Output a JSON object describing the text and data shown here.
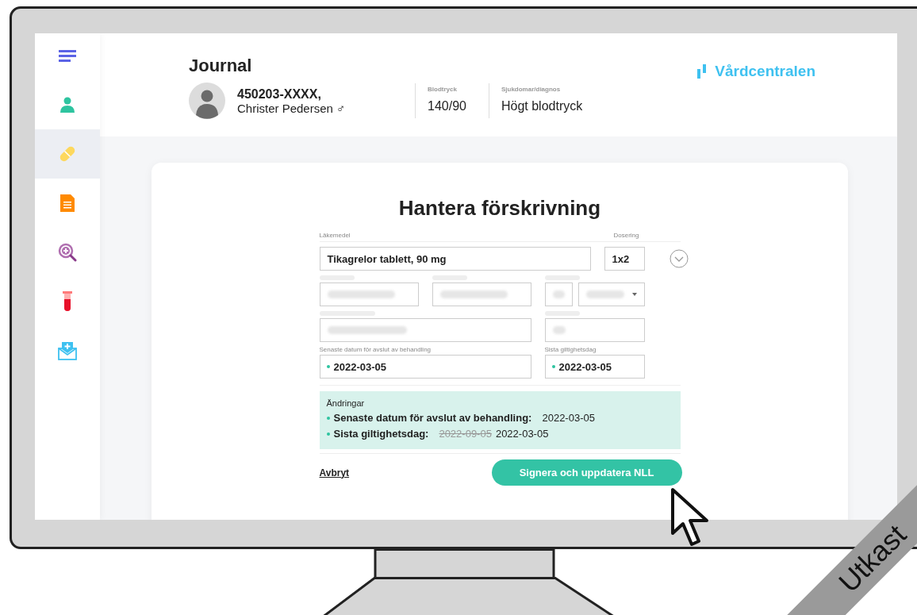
{
  "sidebar": {
    "items": [
      {
        "kind": "menu",
        "selected": false
      },
      {
        "kind": "person",
        "selected": false
      },
      {
        "kind": "pill",
        "selected": true
      },
      {
        "kind": "document",
        "selected": false
      },
      {
        "kind": "search",
        "selected": false
      },
      {
        "kind": "tube",
        "selected": false
      },
      {
        "kind": "mail",
        "selected": false
      }
    ]
  },
  "header": {
    "title": "Journal",
    "patient_id": "450203-XXXX,",
    "patient_name": "Christer Pedersen",
    "gender": "♂",
    "stats": [
      {
        "label": "Blodtryck",
        "value": "140/90"
      },
      {
        "label": "Sjukdomar/diagnos",
        "value": "Högt blodtryck"
      }
    ],
    "brand": "Vårdcentralen"
  },
  "form": {
    "title": "Hantera förskrivning",
    "medicine_label": "Läkemedel",
    "medicine": "Tikagrelor tablett, 90 mg",
    "dose_label": "Dosering",
    "dose": "1x2",
    "dates": [
      {
        "label": "Senaste datum för avslut av behandling",
        "value": "2022-03-05",
        "changed": true
      },
      {
        "label": "Sista giltighetsdag",
        "value": "2022-03-05",
        "changed": true
      }
    ],
    "changes": {
      "title": "Ändringar",
      "items": [
        {
          "label": "Senaste datum för avslut av behandling:",
          "new": "2022-03-05"
        },
        {
          "label": "Sista giltighetsdag:",
          "old": "2022-09-05",
          "new": "2022-03-05"
        }
      ]
    },
    "cancel": "Avbryt",
    "submit": "Signera och uppdatera NLL"
  },
  "ribbon": "Utkast"
}
